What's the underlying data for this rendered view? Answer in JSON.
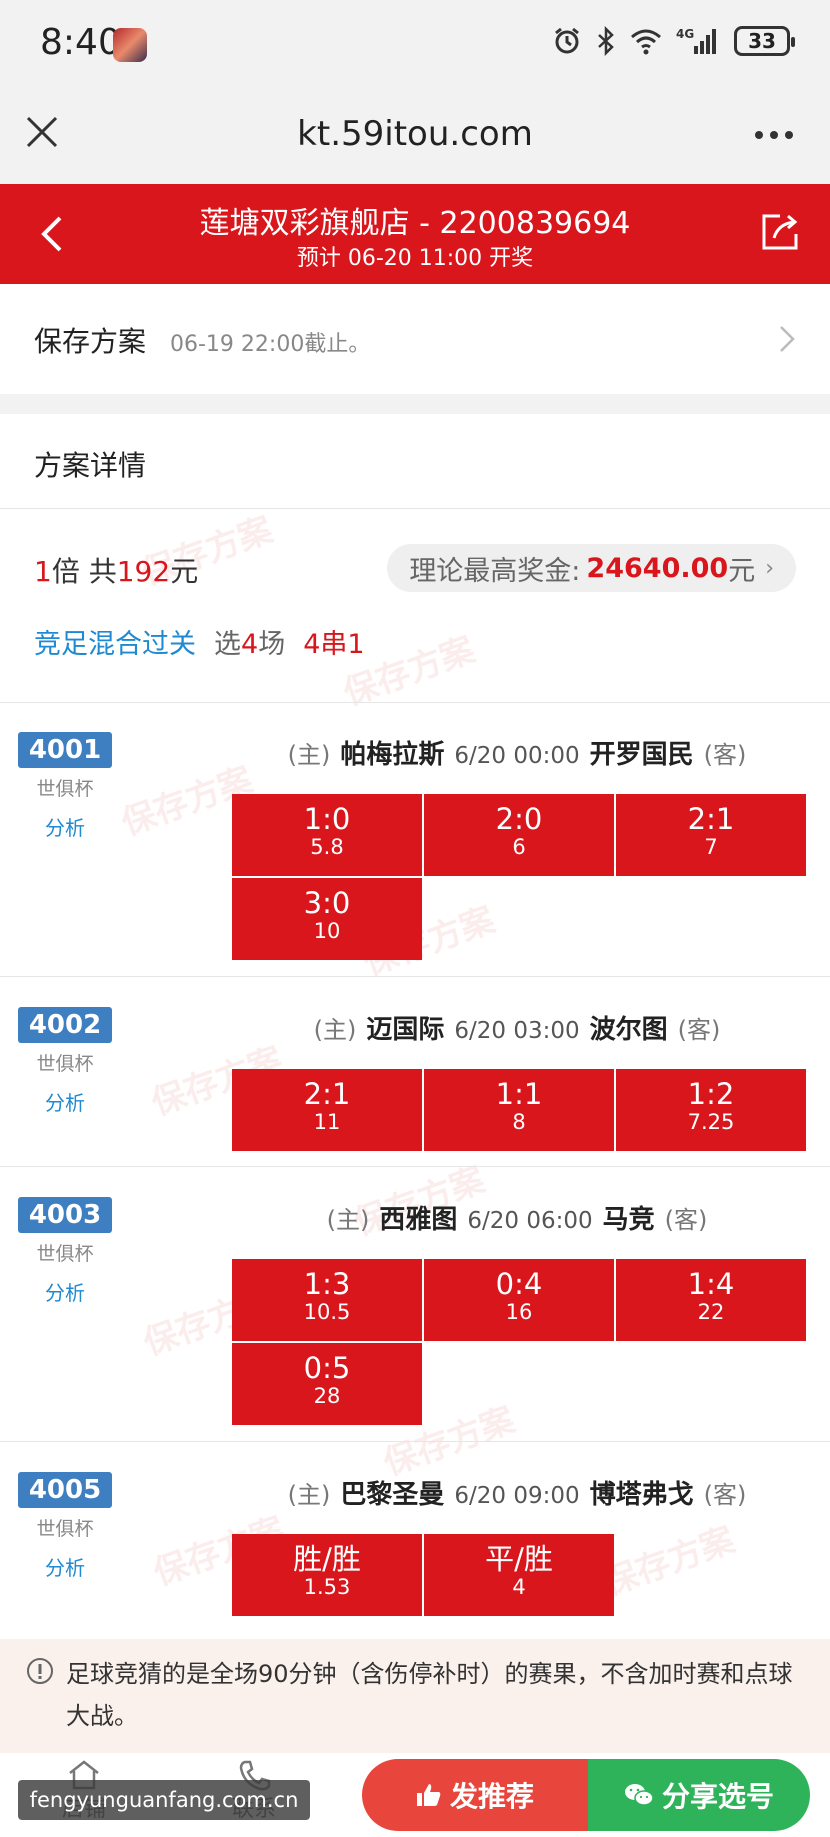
{
  "status_bar": {
    "time": "8:40",
    "battery": "33",
    "network": "4G",
    "icons": [
      "alarm-icon",
      "bluetooth-icon",
      "wifi-icon",
      "signal-icon",
      "battery-icon"
    ]
  },
  "browser": {
    "url": "kt.59itou.com"
  },
  "header": {
    "title": "莲塘双彩旗舰店 - 2200839694",
    "subtitle": "预计 06-20 11:00 开奖",
    "color": "#d8161c"
  },
  "save": {
    "label": "保存方案",
    "deadline": "06-19 22:00截止。"
  },
  "detail": {
    "title": "方案详情",
    "multiplier": "1",
    "multiplier_unit": "倍 共",
    "total": "192",
    "total_unit": "元",
    "prize_label": "理论最高奖金:",
    "prize_amount": "24640.00",
    "prize_unit": "元",
    "play_type": "竞足混合过关",
    "pick_prefix": "选",
    "pick_count": "4",
    "pick_suffix": "场",
    "combo": "4串1",
    "watermark": "保存方案"
  },
  "matches": [
    {
      "no": "4001",
      "league": "世俱杯",
      "analysis": "分析",
      "home_tag": "(主)",
      "home": "帕梅拉斯",
      "time": "6/20 00:00",
      "away": "开罗国民",
      "away_tag": "(客)",
      "odds": [
        {
          "result": "1:0",
          "value": "5.8"
        },
        {
          "result": "2:0",
          "value": "6"
        },
        {
          "result": "2:1",
          "value": "7"
        },
        {
          "result": "3:0",
          "value": "10"
        }
      ]
    },
    {
      "no": "4002",
      "league": "世俱杯",
      "analysis": "分析",
      "home_tag": "(主)",
      "home": "迈国际",
      "time": "6/20 03:00",
      "away": "波尔图",
      "away_tag": "(客)",
      "odds": [
        {
          "result": "2:1",
          "value": "11"
        },
        {
          "result": "1:1",
          "value": "8"
        },
        {
          "result": "1:2",
          "value": "7.25"
        }
      ]
    },
    {
      "no": "4003",
      "league": "世俱杯",
      "analysis": "分析",
      "home_tag": "(主)",
      "home": "西雅图",
      "time": "6/20 06:00",
      "away": "马竞",
      "away_tag": "(客)",
      "odds": [
        {
          "result": "1:3",
          "value": "10.5"
        },
        {
          "result": "0:4",
          "value": "16"
        },
        {
          "result": "1:4",
          "value": "22"
        },
        {
          "result": "0:5",
          "value": "28"
        }
      ]
    },
    {
      "no": "4005",
      "league": "世俱杯",
      "analysis": "分析",
      "home_tag": "(主)",
      "home": "巴黎圣曼",
      "time": "6/20 09:00",
      "away": "博塔弗戈",
      "away_tag": "(客)",
      "odds": [
        {
          "result": "胜/胜",
          "value": "1.53"
        },
        {
          "result": "平/胜",
          "value": "4"
        }
      ]
    }
  ],
  "notice": {
    "text": "足球竞猜的是全场90分钟（含伤停补时）的赛果，不含加时赛和点球大战。"
  },
  "bottom": {
    "nav_shop": "店铺",
    "nav_contact": "联系",
    "recommend": "发推荐",
    "share": "分享选号",
    "site": "fengyunguanfang.com.cn"
  }
}
